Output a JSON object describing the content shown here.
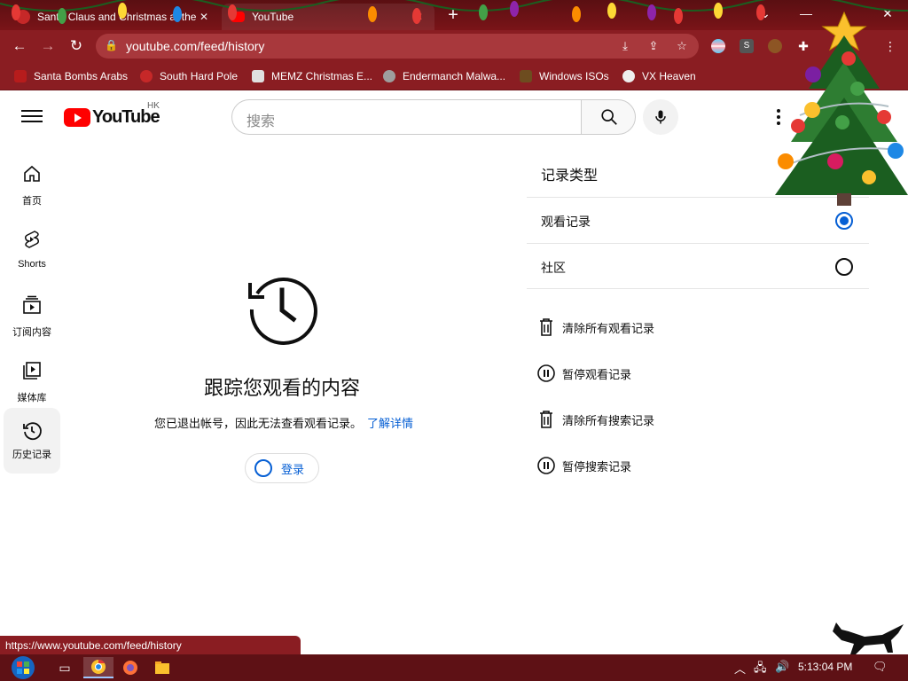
{
  "browser": {
    "tabs": [
      {
        "label": "Santa Claus and Christmas at the",
        "active": false
      },
      {
        "label": "YouTube",
        "active": true
      }
    ],
    "url": "youtube.com/feed/history",
    "bookmarks": [
      {
        "label": "Santa Bombs Arabs",
        "icon": "santa-icon"
      },
      {
        "label": "South Hard Pole",
        "icon": "snowflake-icon"
      },
      {
        "label": "MEMZ Christmas E...",
        "icon": "page-icon"
      },
      {
        "label": "Endermanch Malwa...",
        "icon": "raccoon-icon"
      },
      {
        "label": "Windows ISOs",
        "icon": "tree-icon"
      },
      {
        "label": "VX Heaven",
        "icon": "bio-icon"
      }
    ],
    "extensions": [
      "S"
    ],
    "status_url": "https://www.youtube.com/feed/history"
  },
  "youtube": {
    "logo_text": "YouTube",
    "region": "HK",
    "search_placeholder": "搜索",
    "sidebar": [
      {
        "label": "首页",
        "icon": "home-icon"
      },
      {
        "label": "Shorts",
        "icon": "shorts-icon"
      },
      {
        "label": "订阅内容",
        "icon": "subscriptions-icon"
      },
      {
        "label": "媒体库",
        "icon": "library-icon"
      },
      {
        "label": "历史记录",
        "icon": "history-icon",
        "active": true
      }
    ],
    "main": {
      "title": "跟踪您观看的内容",
      "subtitle": "您已退出帐号，因此无法查看观看记录。",
      "learn_more": "了解详情",
      "signin_label": "登录"
    },
    "history_panel": {
      "heading": "记录类型",
      "types": [
        {
          "label": "观看记录",
          "selected": true
        },
        {
          "label": "社区",
          "selected": false
        }
      ],
      "actions": [
        {
          "label": "清除所有观看记录",
          "icon": "trash-icon"
        },
        {
          "label": "暂停观看记录",
          "icon": "pause-circle-icon"
        },
        {
          "label": "清除所有搜索记录",
          "icon": "trash-icon"
        },
        {
          "label": "暂停搜索记录",
          "icon": "pause-circle-icon"
        }
      ]
    }
  },
  "taskbar": {
    "clock": "5:13:04 PM"
  },
  "colors": {
    "chrome_dark": "#5a0f12",
    "chrome_toolbar": "#8a1d22",
    "youtube_red": "#ff0000",
    "link_blue": "#065fd4"
  }
}
